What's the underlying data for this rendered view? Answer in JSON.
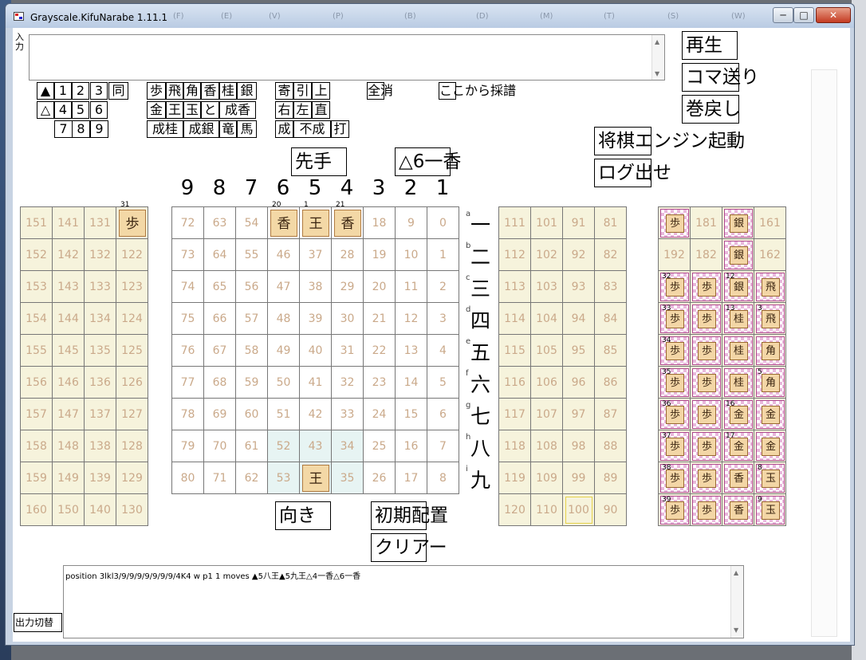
{
  "window": {
    "title": "Grayscale.KifuNarabe 1.11.1",
    "menu_ghost": [
      "(F)",
      "(E)",
      "(V)",
      "(P)",
      "(B)",
      "(D)",
      "(M)",
      "(T)",
      "(S)",
      "(W)"
    ],
    "min": "─",
    "max": "□",
    "close": "✕"
  },
  "input": {
    "label": "入力",
    "value": ""
  },
  "right_buttons": {
    "play": "再生",
    "step": "コマ送り",
    "rewind": "巻戻し",
    "engine": "将棋エンジン起動",
    "log": "ログ出せ"
  },
  "keypad": {
    "rows": [
      [
        "▲",
        "1",
        "2",
        "3",
        "同"
      ],
      [
        "△",
        "4",
        "5",
        "6"
      ],
      [
        "7",
        "8",
        "9"
      ]
    ],
    "pieces": [
      [
        "歩",
        "飛",
        "角",
        "香",
        "桂",
        "銀"
      ],
      [
        "金",
        "王",
        "玉",
        "と",
        "成香"
      ],
      [
        "成桂",
        "成銀",
        "竜",
        "馬"
      ]
    ],
    "mods": [
      [
        "寄",
        "引",
        "上"
      ],
      [
        "右",
        "左",
        "直"
      ],
      [
        "成",
        "不成",
        "打"
      ]
    ],
    "clear_all": "全消",
    "from_here": "ここから採譜"
  },
  "sente_btn": "先手",
  "move_text": "△6一香",
  "file_numbers": [
    "9",
    "8",
    "7",
    "6",
    "5",
    "4",
    "3",
    "2",
    "1"
  ],
  "ranks": [
    "一",
    "二",
    "三",
    "四",
    "五",
    "六",
    "七",
    "八",
    "九"
  ],
  "rank_letters": [
    "a",
    "b",
    "c",
    "d",
    "e",
    "f",
    "g",
    "h",
    "i"
  ],
  "main_board": [
    [
      "72",
      "63",
      "54",
      "",
      "",
      "",
      "18",
      "9",
      "0"
    ],
    [
      "73",
      "64",
      "55",
      "46",
      "37",
      "28",
      "19",
      "10",
      "1"
    ],
    [
      "74",
      "65",
      "56",
      "47",
      "38",
      "29",
      "20",
      "11",
      "2"
    ],
    [
      "75",
      "66",
      "57",
      "48",
      "39",
      "30",
      "21",
      "12",
      "3"
    ],
    [
      "76",
      "67",
      "58",
      "49",
      "40",
      "31",
      "22",
      "13",
      "4"
    ],
    [
      "77",
      "68",
      "59",
      "50",
      "41",
      "32",
      "23",
      "14",
      "5"
    ],
    [
      "78",
      "69",
      "60",
      "51",
      "42",
      "33",
      "24",
      "15",
      "6"
    ],
    [
      "79",
      "70",
      "61",
      "52",
      "43",
      "34",
      "25",
      "16",
      "7"
    ],
    [
      "80",
      "71",
      "62",
      "53",
      "",
      "35",
      "26",
      "17",
      "8"
    ]
  ],
  "board_pieces": [
    {
      "row": 0,
      "col": 3,
      "label": "20",
      "glyph": "香"
    },
    {
      "row": 0,
      "col": 4,
      "label": "1",
      "glyph": "王"
    },
    {
      "row": 0,
      "col": 5,
      "label": "21",
      "glyph": "香"
    },
    {
      "row": 8,
      "col": 4,
      "label": "",
      "glyph": "王"
    }
  ],
  "left_stand": [
    [
      "151",
      "141",
      "131",
      ""
    ],
    [
      "152",
      "142",
      "132",
      "122"
    ],
    [
      "153",
      "143",
      "133",
      "123"
    ],
    [
      "154",
      "144",
      "134",
      "124"
    ],
    [
      "155",
      "145",
      "135",
      "125"
    ],
    [
      "156",
      "146",
      "136",
      "126"
    ],
    [
      "157",
      "147",
      "137",
      "127"
    ],
    [
      "158",
      "148",
      "138",
      "128"
    ],
    [
      "159",
      "149",
      "139",
      "129"
    ],
    [
      "160",
      "150",
      "140",
      "130"
    ]
  ],
  "left_piece": {
    "label": "31",
    "glyph": "歩"
  },
  "right_stand": [
    [
      "111",
      "101",
      "91",
      "81"
    ],
    [
      "112",
      "102",
      "92",
      "82"
    ],
    [
      "113",
      "103",
      "93",
      "83"
    ],
    [
      "114",
      "104",
      "94",
      "84"
    ],
    [
      "115",
      "105",
      "95",
      "85"
    ],
    [
      "116",
      "106",
      "96",
      "86"
    ],
    [
      "117",
      "107",
      "97",
      "87"
    ],
    [
      "118",
      "108",
      "98",
      "88"
    ],
    [
      "119",
      "109",
      "99",
      "89"
    ],
    [
      "120",
      "110",
      "100",
      "90"
    ]
  ],
  "bag": [
    [
      {
        "g": "歩"
      },
      {
        "n": "181"
      },
      {
        "g": "銀"
      },
      {
        "n": "161"
      }
    ],
    [
      {
        "n": "192"
      },
      {
        "n": "182"
      },
      {
        "g": "銀"
      },
      {
        "n": "162"
      }
    ],
    [
      {
        "g": "歩",
        "l": "32"
      },
      {
        "g": "歩"
      },
      {
        "g": "銀",
        "l": "12"
      },
      {
        "g": "飛"
      }
    ],
    [
      {
        "g": "歩",
        "l": "33"
      },
      {
        "g": "歩"
      },
      {
        "g": "桂",
        "l": "13"
      },
      {
        "g": "飛",
        "l": "3"
      }
    ],
    [
      {
        "g": "歩",
        "l": "34"
      },
      {
        "g": "歩"
      },
      {
        "g": "桂"
      },
      {
        "g": "角"
      }
    ],
    [
      {
        "g": "歩",
        "l": "35"
      },
      {
        "g": "歩"
      },
      {
        "g": "桂"
      },
      {
        "g": "角",
        "l": "5"
      }
    ],
    [
      {
        "g": "歩",
        "l": "36"
      },
      {
        "g": "歩"
      },
      {
        "g": "金",
        "l": "16"
      },
      {
        "g": "金"
      }
    ],
    [
      {
        "g": "歩",
        "l": "37"
      },
      {
        "g": "歩"
      },
      {
        "g": "金",
        "l": "17"
      },
      {
        "g": "金"
      }
    ],
    [
      {
        "g": "歩",
        "l": "38"
      },
      {
        "g": "歩"
      },
      {
        "g": "香"
      },
      {
        "g": "玉",
        "l": "8"
      }
    ],
    [
      {
        "g": "歩",
        "l": "39"
      },
      {
        "g": "歩"
      },
      {
        "g": "香"
      },
      {
        "g": "玉",
        "l": "9"
      }
    ]
  ],
  "direction_btn": "向き",
  "initial_btn": "初期配置",
  "clear_btn": "クリアー",
  "output": {
    "value": "position 3lkl3/9/9/9/9/9/9/9/4K4 w p1 1 moves ▲5八王▲5九王△4一香△6一香",
    "toggle": "出力切替"
  }
}
